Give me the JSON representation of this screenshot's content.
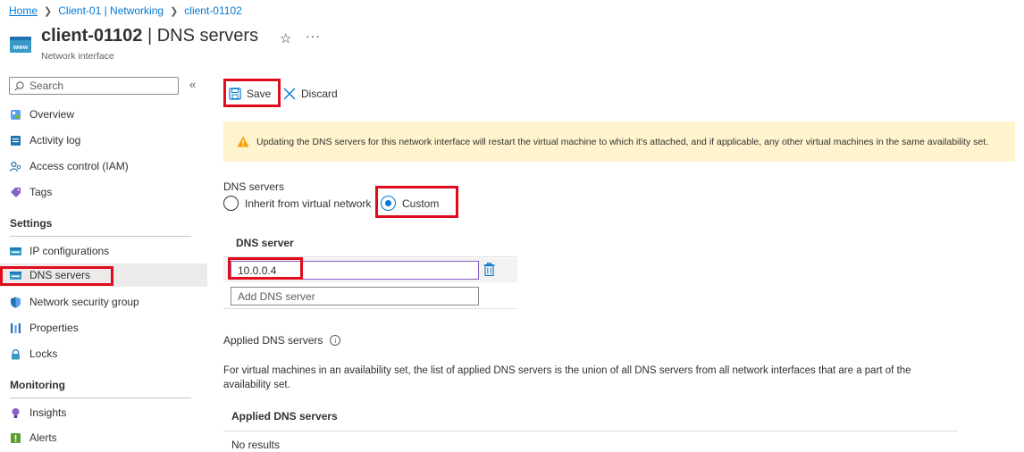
{
  "breadcrumb": {
    "home": "Home",
    "parent": "Client-01 | Networking",
    "current": "client-01102"
  },
  "header": {
    "resource_name": "client-01102",
    "blade_title": "| DNS servers",
    "resource_type": "Network interface",
    "star_icon": "star-icon",
    "more_icon": "more-icon"
  },
  "sidebar": {
    "search_placeholder": "Search",
    "collapse_glyph": "«",
    "top_items": [
      {
        "label": "Overview",
        "icon": "overview-icon"
      },
      {
        "label": "Activity log",
        "icon": "activity-log-icon"
      },
      {
        "label": "Access control (IAM)",
        "icon": "iam-icon"
      },
      {
        "label": "Tags",
        "icon": "tag-icon"
      }
    ],
    "settings_heading": "Settings",
    "settings_items": [
      {
        "label": "IP configurations",
        "icon": "ip-config-icon"
      },
      {
        "label": "DNS servers",
        "icon": "dns-icon",
        "active": true
      },
      {
        "label": "Network security group",
        "icon": "nsg-shield-icon"
      },
      {
        "label": "Properties",
        "icon": "properties-icon"
      },
      {
        "label": "Locks",
        "icon": "lock-icon"
      }
    ],
    "monitoring_heading": "Monitoring",
    "monitoring_items": [
      {
        "label": "Insights",
        "icon": "insights-bulb-icon"
      },
      {
        "label": "Alerts",
        "icon": "alerts-icon"
      }
    ]
  },
  "toolbar": {
    "save_label": "Save",
    "discard_label": "Discard"
  },
  "warning": {
    "text": "Updating the DNS servers for this network interface will restart the virtual machine to which it's attached, and if applicable, any other virtual machines in the same availability set."
  },
  "dns": {
    "section_label": "DNS servers",
    "options": [
      {
        "label": "Inherit from virtual network",
        "checked": false
      },
      {
        "label": "Custom",
        "checked": true
      }
    ],
    "column_header": "DNS server",
    "entries": [
      "10.0.0.4"
    ],
    "add_placeholder": "Add DNS server"
  },
  "applied": {
    "label": "Applied DNS servers",
    "info_glyph": "i",
    "description": "For virtual machines in an availability set, the list of applied DNS servers is the union of all DNS servers from all network interfaces that are a part of the availability set.",
    "column_header": "Applied DNS servers",
    "empty_text": "No results"
  },
  "colors": {
    "accent": "#0078d4",
    "highlight": "#e00b1c",
    "warning_bg": "#fff4ce",
    "active_nav_bg": "#edebe9"
  }
}
